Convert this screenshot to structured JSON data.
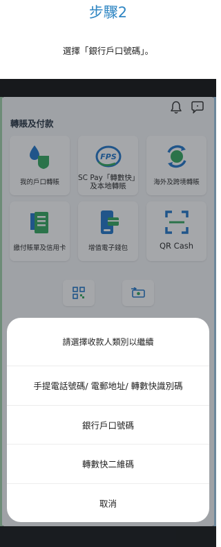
{
  "step_title": "步驟2",
  "instruction": "選擇「銀行戶口號碼」。",
  "app": {
    "section_title": "轉賬及付款",
    "tiles": [
      {
        "label": "我的戶口轉賬"
      },
      {
        "label_line1": "SC Pay「轉數快」",
        "label_line2": "及本地轉賬"
      },
      {
        "label": "海外及跨境轉賬"
      },
      {
        "label": "繳付賬單及信用卡"
      },
      {
        "label": "增值電子錢包"
      },
      {
        "label": "QR Cash"
      }
    ]
  },
  "sheet": {
    "header": "請選擇收款人類別以繼續",
    "options": [
      {
        "label": "手提電話號碼/ 電郵地址/ 轉數快識別碼"
      },
      {
        "label": "銀行戶口號碼"
      },
      {
        "label": "轉數快二維碼"
      }
    ],
    "cancel": "取消"
  },
  "colors": {
    "accent": "#2f86c3",
    "green": "#2ea65a",
    "blue": "#1a73c9"
  }
}
